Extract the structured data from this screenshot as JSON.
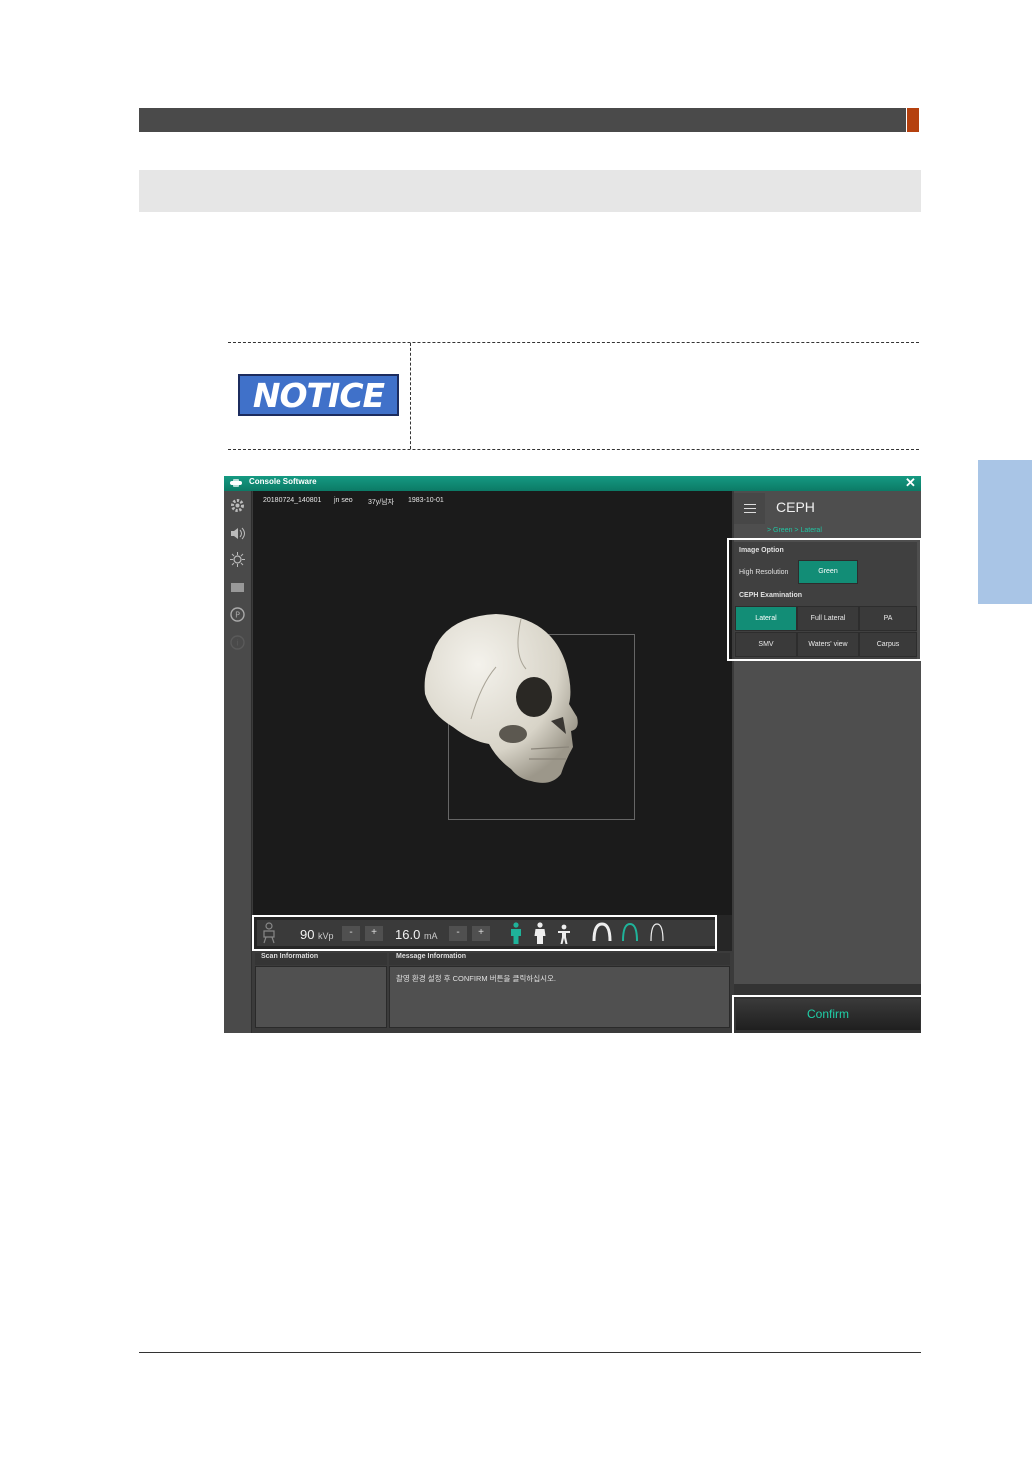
{
  "console": {
    "title": "Console Software",
    "patient": {
      "id": "20180724_140801",
      "name": "jn seo",
      "age_sex": "37y/남자",
      "birth": "1983-10-01"
    },
    "exposure": {
      "kvp_value": "90",
      "kvp_unit": "kVp",
      "ma_value": "16.0",
      "ma_unit": "mA",
      "minus": "-",
      "plus": "+"
    },
    "right_panel": {
      "mode_title": "CEPH",
      "breadcrumb": "> Green > Lateral",
      "image_option_label": "Image Option",
      "high_resolution_label": "High Resolution",
      "green_button": "Green",
      "ceph_exam_label": "CEPH Examination",
      "exam_buttons": [
        "Lateral",
        "Full Lateral",
        "PA",
        "SMV",
        "Waters' view",
        "Carpus"
      ],
      "selected_exam": "Lateral"
    },
    "scan_info_label": "Scan Information",
    "message_info_label": "Message Information",
    "message_text": "촬영 환경 설정 후 CONFIRM 버튼을 클릭하십시오.",
    "confirm_button": "Confirm"
  },
  "notice": {
    "badge": "NOTICE"
  },
  "colors": {
    "accent_teal": "#128d76",
    "header_gray": "#4a4a4a",
    "header_accent": "#b5410f",
    "notice_blue": "#4071c9",
    "side_tab": "#a9c5e6"
  }
}
